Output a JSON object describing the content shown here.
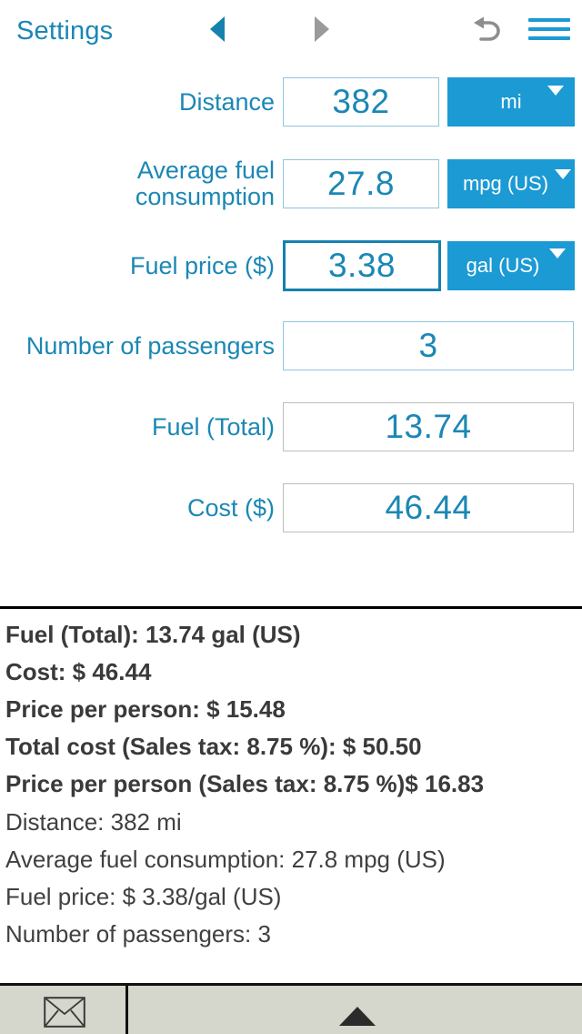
{
  "topbar": {
    "settings_label": "Settings",
    "prev_icon": "left-triangle-icon",
    "next_icon": "right-triangle-icon",
    "undo_icon": "undo-arrow-icon",
    "menu_icon": "hamburger-menu-icon",
    "accent_blue": "#1B9AD4",
    "label_blue": "#1B87B5",
    "disabled_gray": "#9a9a9a"
  },
  "form": {
    "rows": [
      {
        "label": "Distance",
        "value": "382",
        "unit": "mi",
        "state": "editable",
        "has_unit": true
      },
      {
        "label": "Average fuel consumption",
        "value": "27.8",
        "unit": "mpg (US)",
        "state": "editable",
        "has_unit": true
      },
      {
        "label": "Fuel price ($)",
        "value": "3.38",
        "unit": "gal (US)",
        "state": "focused",
        "has_unit": true
      },
      {
        "label": "Number of passengers",
        "value": "3",
        "unit": "",
        "state": "editable",
        "has_unit": false
      },
      {
        "label": "Fuel (Total)",
        "value": "13.74",
        "unit": "",
        "state": "readonly",
        "has_unit": false
      },
      {
        "label": "Cost ($)",
        "value": "46.44",
        "unit": "",
        "state": "readonly",
        "has_unit": false
      }
    ]
  },
  "results": {
    "lines": [
      {
        "text": "Fuel (Total): 13.74 gal (US)",
        "bold": true
      },
      {
        "text": "Cost: $ 46.44",
        "bold": true
      },
      {
        "text": "Price per person: $ 15.48",
        "bold": true
      },
      {
        "text": "Total cost (Sales tax: 8.75 %): $ 50.50",
        "bold": true
      },
      {
        "text": "Price per person (Sales tax: 8.75 %)$ 16.83",
        "bold": true
      },
      {
        "text": "Distance: 382 mi",
        "bold": false
      },
      {
        "text": "Average fuel consumption: 27.8 mpg (US)",
        "bold": false
      },
      {
        "text": "Fuel price: $ 3.38/gal (US)",
        "bold": false
      },
      {
        "text": "Number of passengers: 3",
        "bold": false
      }
    ]
  },
  "bottombar": {
    "mail_icon": "envelope-icon",
    "expand_icon": "up-triangle-icon",
    "background": "#D5D6CC"
  }
}
